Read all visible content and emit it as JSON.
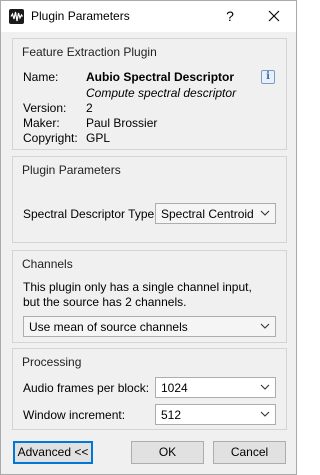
{
  "window": {
    "title": "Plugin Parameters",
    "help_glyph": "?",
    "close_glyph": "✕"
  },
  "feature_group": {
    "title": "Feature Extraction Plugin",
    "name_label": "Name:",
    "name_value": "Aubio Spectral Descriptor",
    "description": "Compute spectral descriptor",
    "version_label": "Version:",
    "version_value": "2",
    "maker_label": "Maker:",
    "maker_value": "Paul Brossier",
    "copyright_label": "Copyright:",
    "copyright_value": "GPL",
    "info_glyph": "i"
  },
  "params_group": {
    "title": "Plugin Parameters",
    "descriptor_label": "Spectral Descriptor Type",
    "descriptor_value": "Spectral Centroid"
  },
  "channels_group": {
    "title": "Channels",
    "line1": "This plugin only has a single channel input,",
    "line2": "but the source has 2 channels.",
    "mode_value": "Use mean of source channels"
  },
  "processing_group": {
    "title": "Processing",
    "frames_label": "Audio frames per block:",
    "frames_value": "1024",
    "increment_label": "Window increment:",
    "increment_value": "512"
  },
  "buttons": {
    "advanced": "Advanced <<",
    "ok": "OK",
    "cancel": "Cancel"
  }
}
